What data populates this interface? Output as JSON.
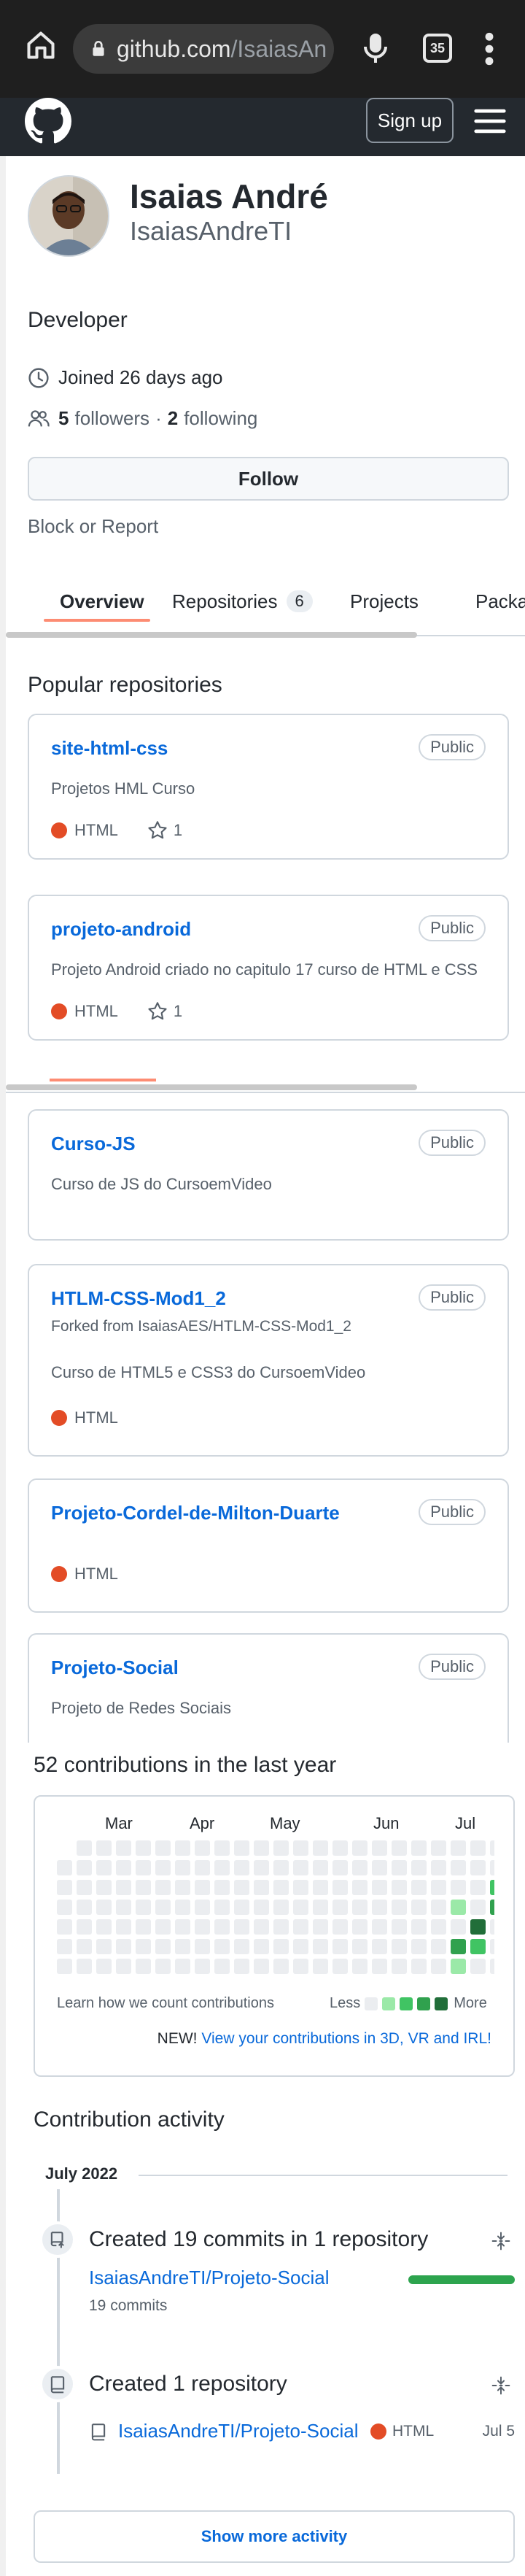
{
  "browser": {
    "url_host": "github.com",
    "url_path": "/IsaiasAn",
    "tab_count": "35"
  },
  "header": {
    "signup_label": "Sign up"
  },
  "profile": {
    "name": "Isaias André",
    "login": "IsaiasAndreTI",
    "bio": "Developer",
    "joined": "Joined 26 days ago",
    "followers_count": "5",
    "followers_label": "followers",
    "separator": "·",
    "following_count": "2",
    "following_label": "following",
    "follow_label": "Follow",
    "block_label": "Block or Report"
  },
  "tabs": [
    {
      "label": "Overview"
    },
    {
      "label": "Repositories",
      "count": "6"
    },
    {
      "label": "Projects"
    },
    {
      "label": "Packages"
    }
  ],
  "popular_title": "Popular repositories",
  "repos": [
    {
      "name": "site-html-css",
      "badge": "Public",
      "description": "Projetos HML Curso",
      "language": "HTML",
      "stars": "1"
    },
    {
      "name": "projeto-android",
      "badge": "Public",
      "description": "Projeto Android criado no capitulo 17 curso de HTML e CSS",
      "language": "HTML",
      "stars": "1"
    },
    {
      "name": "Curso-JS",
      "badge": "Public",
      "description": "Curso de JS do CursoemVideo"
    },
    {
      "name": "HTLM-CSS-Mod1_2",
      "badge": "Public",
      "forked": "Forked from IsaiasAES/HTLM-CSS-Mod1_2",
      "description": "Curso de HTML5 e CSS3 do CursoemVideo",
      "language": "HTML"
    },
    {
      "name": "Projeto-Cordel-de-Milton-Duarte",
      "badge": "Public",
      "language": "HTML"
    },
    {
      "name": "Projeto-Social",
      "badge": "Public",
      "description": "Projeto de Redes Sociais"
    }
  ],
  "contributions": {
    "title": "52 contributions in the last year",
    "months": [
      "Mar",
      "Apr",
      "May",
      "Jun",
      "Jul"
    ],
    "learn_label": "Learn how we count contributions",
    "less_label": "Less",
    "more_label": "More",
    "new_label": "NEW!",
    "new_link": "View your contributions in 3D, VR and IRL!",
    "colors": [
      "#ebedf0",
      "#9be9a8",
      "#40c463",
      "#30a14e",
      "#216e39"
    ]
  },
  "activity": {
    "title": "Contribution activity",
    "month": "July 2022",
    "items": [
      {
        "headline": "Created 19 commits in 1 repository",
        "repo": "IsaiasAndreTI/Projeto-Social",
        "commits": "19 commits",
        "share": 1.0
      },
      {
        "headline": "Created 1 repository",
        "repo": "IsaiasAndreTI/Projeto-Social",
        "language": "HTML",
        "date": "Jul 5"
      }
    ],
    "show_more": "Show more activity"
  }
}
